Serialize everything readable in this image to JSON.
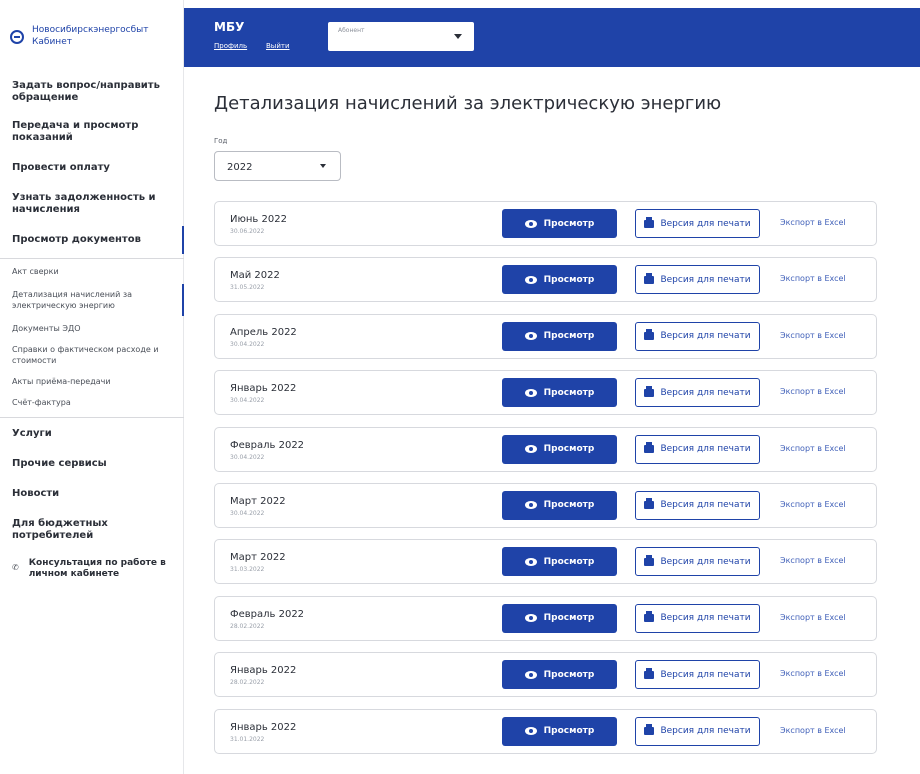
{
  "brand": {
    "line1": "Новосибирскэнергосбыт",
    "line2": "Кабинет"
  },
  "sidebar": {
    "items": [
      {
        "label": "Задать вопрос/направить обращение"
      },
      {
        "label": "Передача и просмотр показаний"
      },
      {
        "label": "Провести оплату"
      },
      {
        "label": "Узнать задолженность и начисления"
      },
      {
        "label": "Просмотр документов"
      }
    ],
    "docs_sub": [
      {
        "label": "Акт сверки"
      },
      {
        "label": "Детализация начислений за электрическую энергию"
      },
      {
        "label": "Документы ЭДО"
      },
      {
        "label": "Справки о фактическом расходе и стоимости"
      },
      {
        "label": "Акты приёма-передачи"
      },
      {
        "label": "Счёт-фактура"
      }
    ],
    "bottom": [
      {
        "label": "Услуги"
      },
      {
        "label": "Прочие сервисы"
      },
      {
        "label": "Новости"
      },
      {
        "label": "Для бюджетных потребителей"
      }
    ],
    "consult": "Консультация по работе в личном кабинете"
  },
  "header": {
    "user": "МБУ",
    "profile": "Профиль",
    "logout": "Выйти",
    "subscriber_placeholder": "Абонент"
  },
  "page": {
    "title": "Детализация начислений за электрическую энергию",
    "year_label": "Год",
    "year_value": "2022"
  },
  "actions": {
    "view": "Просмотр",
    "print": "Версия для печати",
    "excel": "Экспорт в Excel"
  },
  "rows": [
    {
      "title": "Июнь 2022",
      "date": "30.06.2022"
    },
    {
      "title": "Май 2022",
      "date": "31.05.2022"
    },
    {
      "title": "Апрель 2022",
      "date": "30.04.2022"
    },
    {
      "title": "Январь 2022",
      "date": "30.04.2022"
    },
    {
      "title": "Февраль 2022",
      "date": "30.04.2022"
    },
    {
      "title": "Март 2022",
      "date": "30.04.2022"
    },
    {
      "title": "Март 2022",
      "date": "31.03.2022"
    },
    {
      "title": "Февраль 2022",
      "date": "28.02.2022"
    },
    {
      "title": "Январь 2022",
      "date": "28.02.2022"
    },
    {
      "title": "Январь 2022",
      "date": "31.01.2022"
    }
  ],
  "colors": {
    "brand_blue": "#1f43a8"
  }
}
